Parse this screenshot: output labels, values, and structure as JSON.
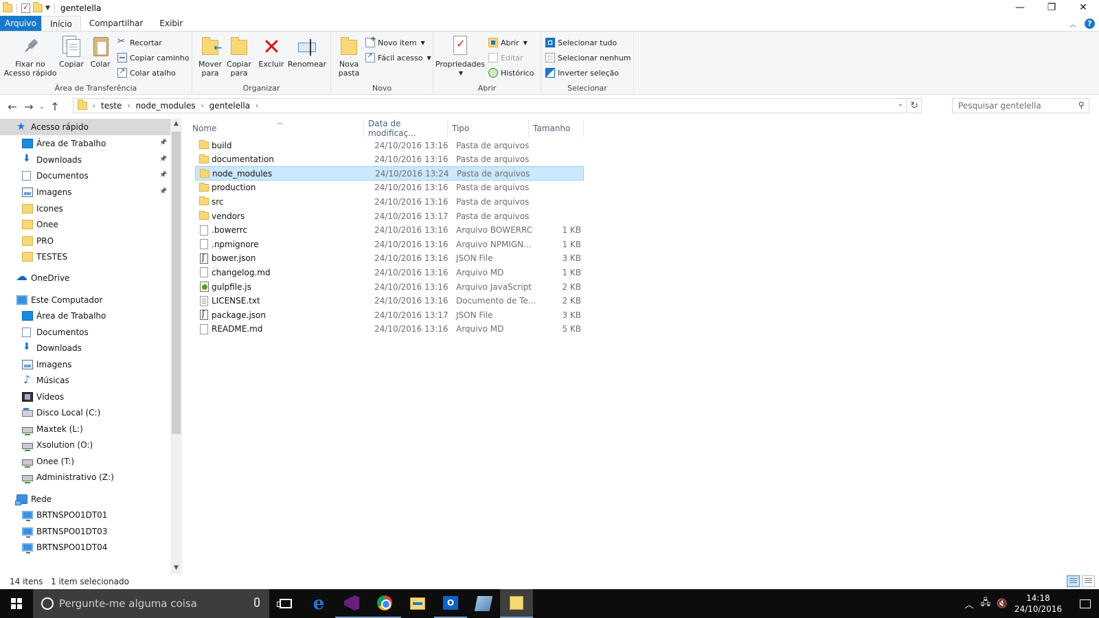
{
  "window": {
    "title": "gentelella",
    "controls": {
      "minimize": "—",
      "maximize": "❐",
      "close": "✕"
    }
  },
  "ribbon_tabs": [
    {
      "label": "Arquivo"
    },
    {
      "label": "Início"
    },
    {
      "label": "Compartilhar"
    },
    {
      "label": "Exibir"
    }
  ],
  "ribbon": {
    "clipboard": {
      "label": "Área de Transferência",
      "pin": "Fixar no\nAcesso rápido",
      "copy": "Copiar",
      "paste": "Colar",
      "cut": "Recortar",
      "copy_path": "Copiar caminho",
      "paste_shortcut": "Colar atalho"
    },
    "organize": {
      "label": "Organizar",
      "move_to": "Mover\npara",
      "copy_to": "Copiar\npara",
      "delete": "Excluir",
      "rename": "Renomear"
    },
    "new": {
      "label": "Novo",
      "new_folder": "Nova\npasta",
      "new_item": "Novo item",
      "easy_access": "Fácil acesso"
    },
    "open": {
      "label": "Abrir",
      "properties": "Propriedades",
      "open": "Abrir",
      "edit": "Editar",
      "history": "Histórico"
    },
    "select": {
      "label": "Selecionar",
      "select_all": "Selecionar tudo",
      "select_none": "Selecionar nenhum",
      "invert": "Inverter seleção"
    }
  },
  "address": {
    "crumbs": [
      "teste",
      "node_modules",
      "gentelella"
    ]
  },
  "search": {
    "placeholder": "Pesquisar gentelella"
  },
  "sidebar": {
    "items": [
      {
        "label": "Acesso rápido",
        "icon": "star-icon",
        "pinned": false
      },
      {
        "label": "Área de Trabalho",
        "icon": "desktop-icon",
        "pinned": true
      },
      {
        "label": "Downloads",
        "icon": "download-icon",
        "pinned": true
      },
      {
        "label": "Documentos",
        "icon": "documents-icon",
        "pinned": true
      },
      {
        "label": "Imagens",
        "icon": "pictures-icon",
        "pinned": true
      },
      {
        "label": "Icones",
        "icon": "folder-icon",
        "pinned": false
      },
      {
        "label": "Onee",
        "icon": "folder-icon",
        "pinned": false
      },
      {
        "label": "PRO",
        "icon": "folder-icon",
        "pinned": false
      },
      {
        "label": "TESTES",
        "icon": "folder-icon",
        "pinned": false
      },
      {
        "label": "OneDrive",
        "icon": "cloud-icon",
        "pinned": false
      },
      {
        "label": "Este Computador",
        "icon": "computer-icon",
        "pinned": false
      },
      {
        "label": "Área de Trabalho",
        "icon": "desktop-icon",
        "pinned": false
      },
      {
        "label": "Documentos",
        "icon": "documents-icon",
        "pinned": false
      },
      {
        "label": "Downloads",
        "icon": "download-icon",
        "pinned": false
      },
      {
        "label": "Imagens",
        "icon": "pictures-icon",
        "pinned": false
      },
      {
        "label": "Músicas",
        "icon": "music-icon",
        "pinned": false
      },
      {
        "label": "Vídeos",
        "icon": "video-icon",
        "pinned": false
      },
      {
        "label": "Disco Local (C:)",
        "icon": "disk-icon",
        "pinned": false
      },
      {
        "label": "Maxtek (L:)",
        "icon": "network-drive-icon",
        "pinned": false
      },
      {
        "label": "Xsolution (O:)",
        "icon": "network-drive-icon",
        "pinned": false
      },
      {
        "label": "Onee (T:)",
        "icon": "network-drive-icon",
        "pinned": false
      },
      {
        "label": "Administrativo (Z:)",
        "icon": "network-drive-icon",
        "pinned": false
      },
      {
        "label": "Rede",
        "icon": "network-icon",
        "pinned": false
      },
      {
        "label": "BRTNSPO01DT01",
        "icon": "monitor-icon",
        "pinned": false
      },
      {
        "label": "BRTNSPO01DT03",
        "icon": "monitor-icon",
        "pinned": false
      },
      {
        "label": "BRTNSPO01DT04",
        "icon": "monitor-icon",
        "pinned": false
      }
    ]
  },
  "columns": {
    "name": "Nome",
    "date": "Data de modificaç...",
    "type": "Tipo",
    "size": "Tamanho"
  },
  "files": [
    {
      "name": "build",
      "date": "24/10/2016 13:16",
      "type": "Pasta de arquivos",
      "size": "",
      "kind": "folder"
    },
    {
      "name": "documentation",
      "date": "24/10/2016 13:16",
      "type": "Pasta de arquivos",
      "size": "",
      "kind": "folder"
    },
    {
      "name": "node_modules",
      "date": "24/10/2016 13:24",
      "type": "Pasta de arquivos",
      "size": "",
      "kind": "folder",
      "selected": true
    },
    {
      "name": "production",
      "date": "24/10/2016 13:16",
      "type": "Pasta de arquivos",
      "size": "",
      "kind": "folder"
    },
    {
      "name": "src",
      "date": "24/10/2016 13:16",
      "type": "Pasta de arquivos",
      "size": "",
      "kind": "folder"
    },
    {
      "name": "vendors",
      "date": "24/10/2016 13:17",
      "type": "Pasta de arquivos",
      "size": "",
      "kind": "folder"
    },
    {
      "name": ".bowerrc",
      "date": "24/10/2016 13:16",
      "type": "Arquivo BOWERRC",
      "size": "1 KB",
      "kind": "file"
    },
    {
      "name": ".npmignore",
      "date": "24/10/2016 13:16",
      "type": "Arquivo NPMIGN...",
      "size": "1 KB",
      "kind": "file"
    },
    {
      "name": "bower.json",
      "date": "24/10/2016 13:16",
      "type": "JSON File",
      "size": "3 KB",
      "kind": "json"
    },
    {
      "name": "changelog.md",
      "date": "24/10/2016 13:16",
      "type": "Arquivo MD",
      "size": "1 KB",
      "kind": "file"
    },
    {
      "name": "gulpfile.js",
      "date": "24/10/2016 13:16",
      "type": "Arquivo JavaScript",
      "size": "2 KB",
      "kind": "js"
    },
    {
      "name": "LICENSE.txt",
      "date": "24/10/2016 13:16",
      "type": "Documento de Te...",
      "size": "2 KB",
      "kind": "txt"
    },
    {
      "name": "package.json",
      "date": "24/10/2016 13:17",
      "type": "JSON File",
      "size": "3 KB",
      "kind": "json"
    },
    {
      "name": "README.md",
      "date": "24/10/2016 13:16",
      "type": "Arquivo MD",
      "size": "5 KB",
      "kind": "file"
    }
  ],
  "status": {
    "count": "14 itens",
    "selected": "1 item selecionado"
  },
  "taskbar": {
    "search_placeholder": "Pergunte-me alguma coisa",
    "time": "14:18",
    "date": "24/10/2016"
  }
}
